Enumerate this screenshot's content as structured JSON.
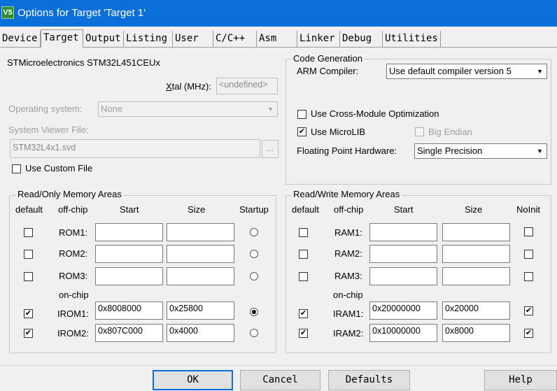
{
  "window": {
    "title": "Options for Target 'Target 1'",
    "app_icon": "V5"
  },
  "tabs": [
    "Device",
    "Target",
    "Output",
    "Listing",
    "User",
    "C/C++",
    "Asm",
    "Linker",
    "Debug",
    "Utilities"
  ],
  "device_name": "STMicroelectronics STM32L451CEUx",
  "xtal": {
    "label_prefix": "X",
    "label_rest": "tal (MHz):",
    "value": "<undefined>"
  },
  "os": {
    "label": "Operating system:",
    "value": "None"
  },
  "svf": {
    "label": "System Viewer File:",
    "value": "STM32L4x1.svd",
    "browse": "..."
  },
  "custom_file": {
    "label": "Use Custom File",
    "checked": false
  },
  "code_gen": {
    "title": "Code Generation",
    "compiler_label": "ARM Compiler:",
    "compiler_value": "Use default compiler version 5",
    "cross_module": {
      "label": "Use Cross-Module Optimization",
      "checked": false
    },
    "microlib": {
      "label": "Use MicroLIB",
      "checked": true
    },
    "big_endian": {
      "label": "Big Endian",
      "checked": false
    },
    "fpu_label": "Floating Point Hardware:",
    "fpu_value": "Single Precision"
  },
  "ro_mem": {
    "title": "Read/Only Memory Areas",
    "headers": {
      "default": "default",
      "offchip": "off-chip",
      "start": "Start",
      "size": "Size",
      "last": "Startup"
    },
    "onchip_label": "on-chip",
    "rows": [
      {
        "name": "ROM1:",
        "start": "",
        "size": "",
        "default": false,
        "startup": false
      },
      {
        "name": "ROM2:",
        "start": "",
        "size": "",
        "default": false,
        "startup": false
      },
      {
        "name": "ROM3:",
        "start": "",
        "size": "",
        "default": false,
        "startup": false
      },
      {
        "name": "IROM1:",
        "start": "0x8008000",
        "size": "0x25800",
        "default": true,
        "startup": true
      },
      {
        "name": "IROM2:",
        "start": "0x807C000",
        "size": "0x4000",
        "default": true,
        "startup": false
      }
    ]
  },
  "rw_mem": {
    "title": "Read/Write Memory Areas",
    "headers": {
      "default": "default",
      "offchip": "off-chip",
      "start": "Start",
      "size": "Size",
      "last": "NoInit"
    },
    "onchip_label": "on-chip",
    "rows": [
      {
        "name": "RAM1:",
        "start": "",
        "size": "",
        "default": false,
        "noinit": false
      },
      {
        "name": "RAM2:",
        "start": "",
        "size": "",
        "default": false,
        "noinit": false
      },
      {
        "name": "RAM3:",
        "start": "",
        "size": "",
        "default": false,
        "noinit": false
      },
      {
        "name": "IRAM1:",
        "start": "0x20000000",
        "size": "0x20000",
        "default": true,
        "noinit": true
      },
      {
        "name": "IRAM2:",
        "start": "0x10000000",
        "size": "0x8000",
        "default": true,
        "noinit": true
      }
    ]
  },
  "buttons": {
    "ok": "OK",
    "cancel": "Cancel",
    "defaults": "Defaults",
    "help": "Help"
  },
  "colors": {
    "titlebar": "#0a6fd8",
    "window_bg": "#f0f0f0"
  }
}
